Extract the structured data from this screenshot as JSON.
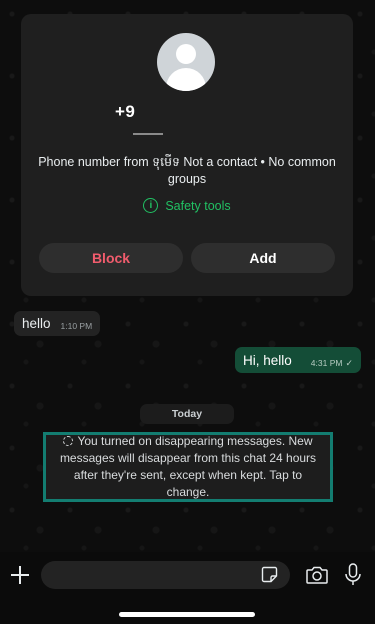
{
  "contact_card": {
    "phone": "+9",
    "info": "Phone number from ទុមើទ Not a contact • No common groups",
    "safety_tools": "Safety tools",
    "block_label": "Block",
    "add_label": "Add"
  },
  "messages": [
    {
      "text": "hello",
      "time": "1:10 PM",
      "direction": "incoming"
    },
    {
      "text": "Hi, hello",
      "time": "4:31 PM",
      "direction": "outgoing",
      "status": "✓"
    }
  ],
  "date_divider": "Today",
  "system_message": "You turned on disappearing messages. New messages will disappear from this chat 24 hours after they're sent, except when kept. Tap to change.",
  "composer": {
    "placeholder": ""
  },
  "colors": {
    "accent_green": "#21c063",
    "block_red": "#f15c6d",
    "outgoing_bubble": "#144d37",
    "highlight_border": "#137d71"
  },
  "icons": [
    "info-icon",
    "timer-icon",
    "plus-icon",
    "sticker-icon",
    "camera-icon",
    "mic-icon"
  ]
}
